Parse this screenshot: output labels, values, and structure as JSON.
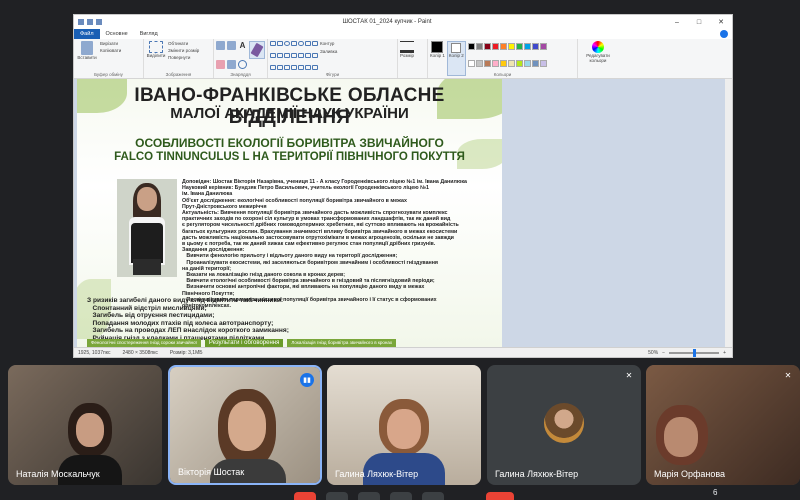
{
  "paint": {
    "title": "ШОСТАК 01_2024 купчик - Paint",
    "menu": [
      "Файл",
      "Основне",
      "Вигляд"
    ],
    "ribbon_groups": [
      "Буфер обміну",
      "Зображення",
      "Знаряддя",
      "Фігури",
      "Кольори"
    ],
    "ribbon_buttons": {
      "paste": "Вставити",
      "cut": "Вирізати",
      "copy": "Копіювати",
      "select": "Виділити",
      "crop": "Обтинати",
      "resize": "Змінити розмір",
      "rotate": "Повернути",
      "outline": "Контур",
      "fill": "Заливка",
      "size": "Розмір",
      "color1": "Колір 1",
      "color2": "Колір 2",
      "edit_colors": "Редагувати кольори"
    },
    "palette": [
      "#000000",
      "#7f7f7f",
      "#880015",
      "#ed1c24",
      "#ff7f27",
      "#fff200",
      "#22b14c",
      "#00a2e8",
      "#3f48cc",
      "#a349a4",
      "#ffffff",
      "#c3c3c3",
      "#b97a57",
      "#ffaec9",
      "#ffc90e",
      "#efe4b0",
      "#b5e61d",
      "#99d9ea",
      "#7092be",
      "#c8bfe7"
    ],
    "status": {
      "cursor": "1925, 1037пкс",
      "image_size": "2480 × 3508пкс",
      "file_size": "Розмір: 3,1МБ",
      "zoom": "50%",
      "zoom_fraction": 0.5
    }
  },
  "poster": {
    "title_line1": "ІВАНО-ФРАНКІВСЬКЕ ОБЛАСНЕ ВІДДІЛЕННЯ",
    "title_line2": "МАЛОЇ АКАДЕМІЇ НАУК УКРАЇНИ",
    "heading_line1": "ОСОБЛИВОСТІ ЕКОЛОГІЇ БОРИВІТРА ЗВИЧАЙНОГО",
    "heading_line2": "FALCO TINNUNCULUS L НА ТЕРИТОРІЇ ПІВНІЧНОГО ПОКУТТЯ",
    "text_block": [
      "Доповідач: Шостак Вікторія Назарівна, учениця 11 - А класу Городенківського ліцею №1 ім. Івана Данилюка",
      "Науковий керівник: Бундзяк Петро Васильович, учитель екології Городенківського ліцею №1",
      "ім. Івана Данилюка",
      "Об'єкт дослідження: екологічні особливості популяції боривітра звичайного в межах",
      "Прут-Дністровського межиріччя",
      "Актуальність: Вивчення популяції боривітра звичайного дасть можливість спрогнозувати комплекс",
      "практичних заходів по охороні сіл культур в умовах трансформованих ландшафтів, так як даний вид",
      "є регулятором чисельності дрібних гомоводотермних хребетних, які суттєво впливають на врожайність",
      "багатьох культурних рослин. Врахування значимості впливу боривітра звичайного в межах екосистеми",
      "дасть можливість національно застосовувати отрутохімікати в межах агроценозів, оскільки не завжди",
      "в цьому є потреба, так як даний хижак сам ефективно регулює стан популяції дрібних гризунів.",
      "Завдання дослідження:",
      "   Вивчити фенологію прильоту і відльоту даного виду на території дослідження;",
      "   Проаналізувати екосистеми, які заселяються боривітром звичайним і особливості гніздування",
      "на даній території;",
      "   Вказати на локалізацію гнізд даного сокола в кронах дерев;",
      "   Вивчити етологічні особливості боривітра звичайного в гніздовий та післягніздовий періоди;",
      "   Визначити основні антропічні фактори, які впливають на популяцію даного виду в межах",
      "Північного Покуття;",
      "   Проаналізувати параметри місцевої популяції боривітра звичайного і її статус в сформованих",
      "орнітокомплексах."
    ],
    "risk_block": [
      "З ризиків загибелі даного виду слід відмітити такі чинники:",
      "   Спонтанний відстріл мисливцями;",
      "   Загибель від отруєння пестицидами;",
      "   Попадання молодих птахів під колеса автотранспорту;",
      "   Загибель на проводах ЛЕП внаслідок короткого замикання;",
      "   Руйнація гнізд з кладками і пташенятами підлітками."
    ],
    "footer": [
      "Фенологічні спостереження гнізд сороки звичайної",
      "Результати і обговорення",
      "Локалізація гнізд боривітра звичайного в кронах"
    ]
  },
  "participants": [
    {
      "name": "Наталія Москальчук",
      "muted": false,
      "speaking": false
    },
    {
      "name": "Вікторія Шостак",
      "muted": false,
      "speaking": true
    },
    {
      "name": "Галина Ляхюк-Вітер",
      "muted": false,
      "speaking": false
    },
    {
      "name": "Галина Ляхюк-Вітер",
      "muted": true,
      "speaking": false
    },
    {
      "name": "Марія Орфанова",
      "muted": true,
      "speaking": false
    }
  ],
  "participant_count": "6",
  "colors": {
    "meet_bg": "#202124",
    "tile_bg": "#3c4043",
    "accent": "#1a73e8",
    "end_call": "#ea4335"
  }
}
